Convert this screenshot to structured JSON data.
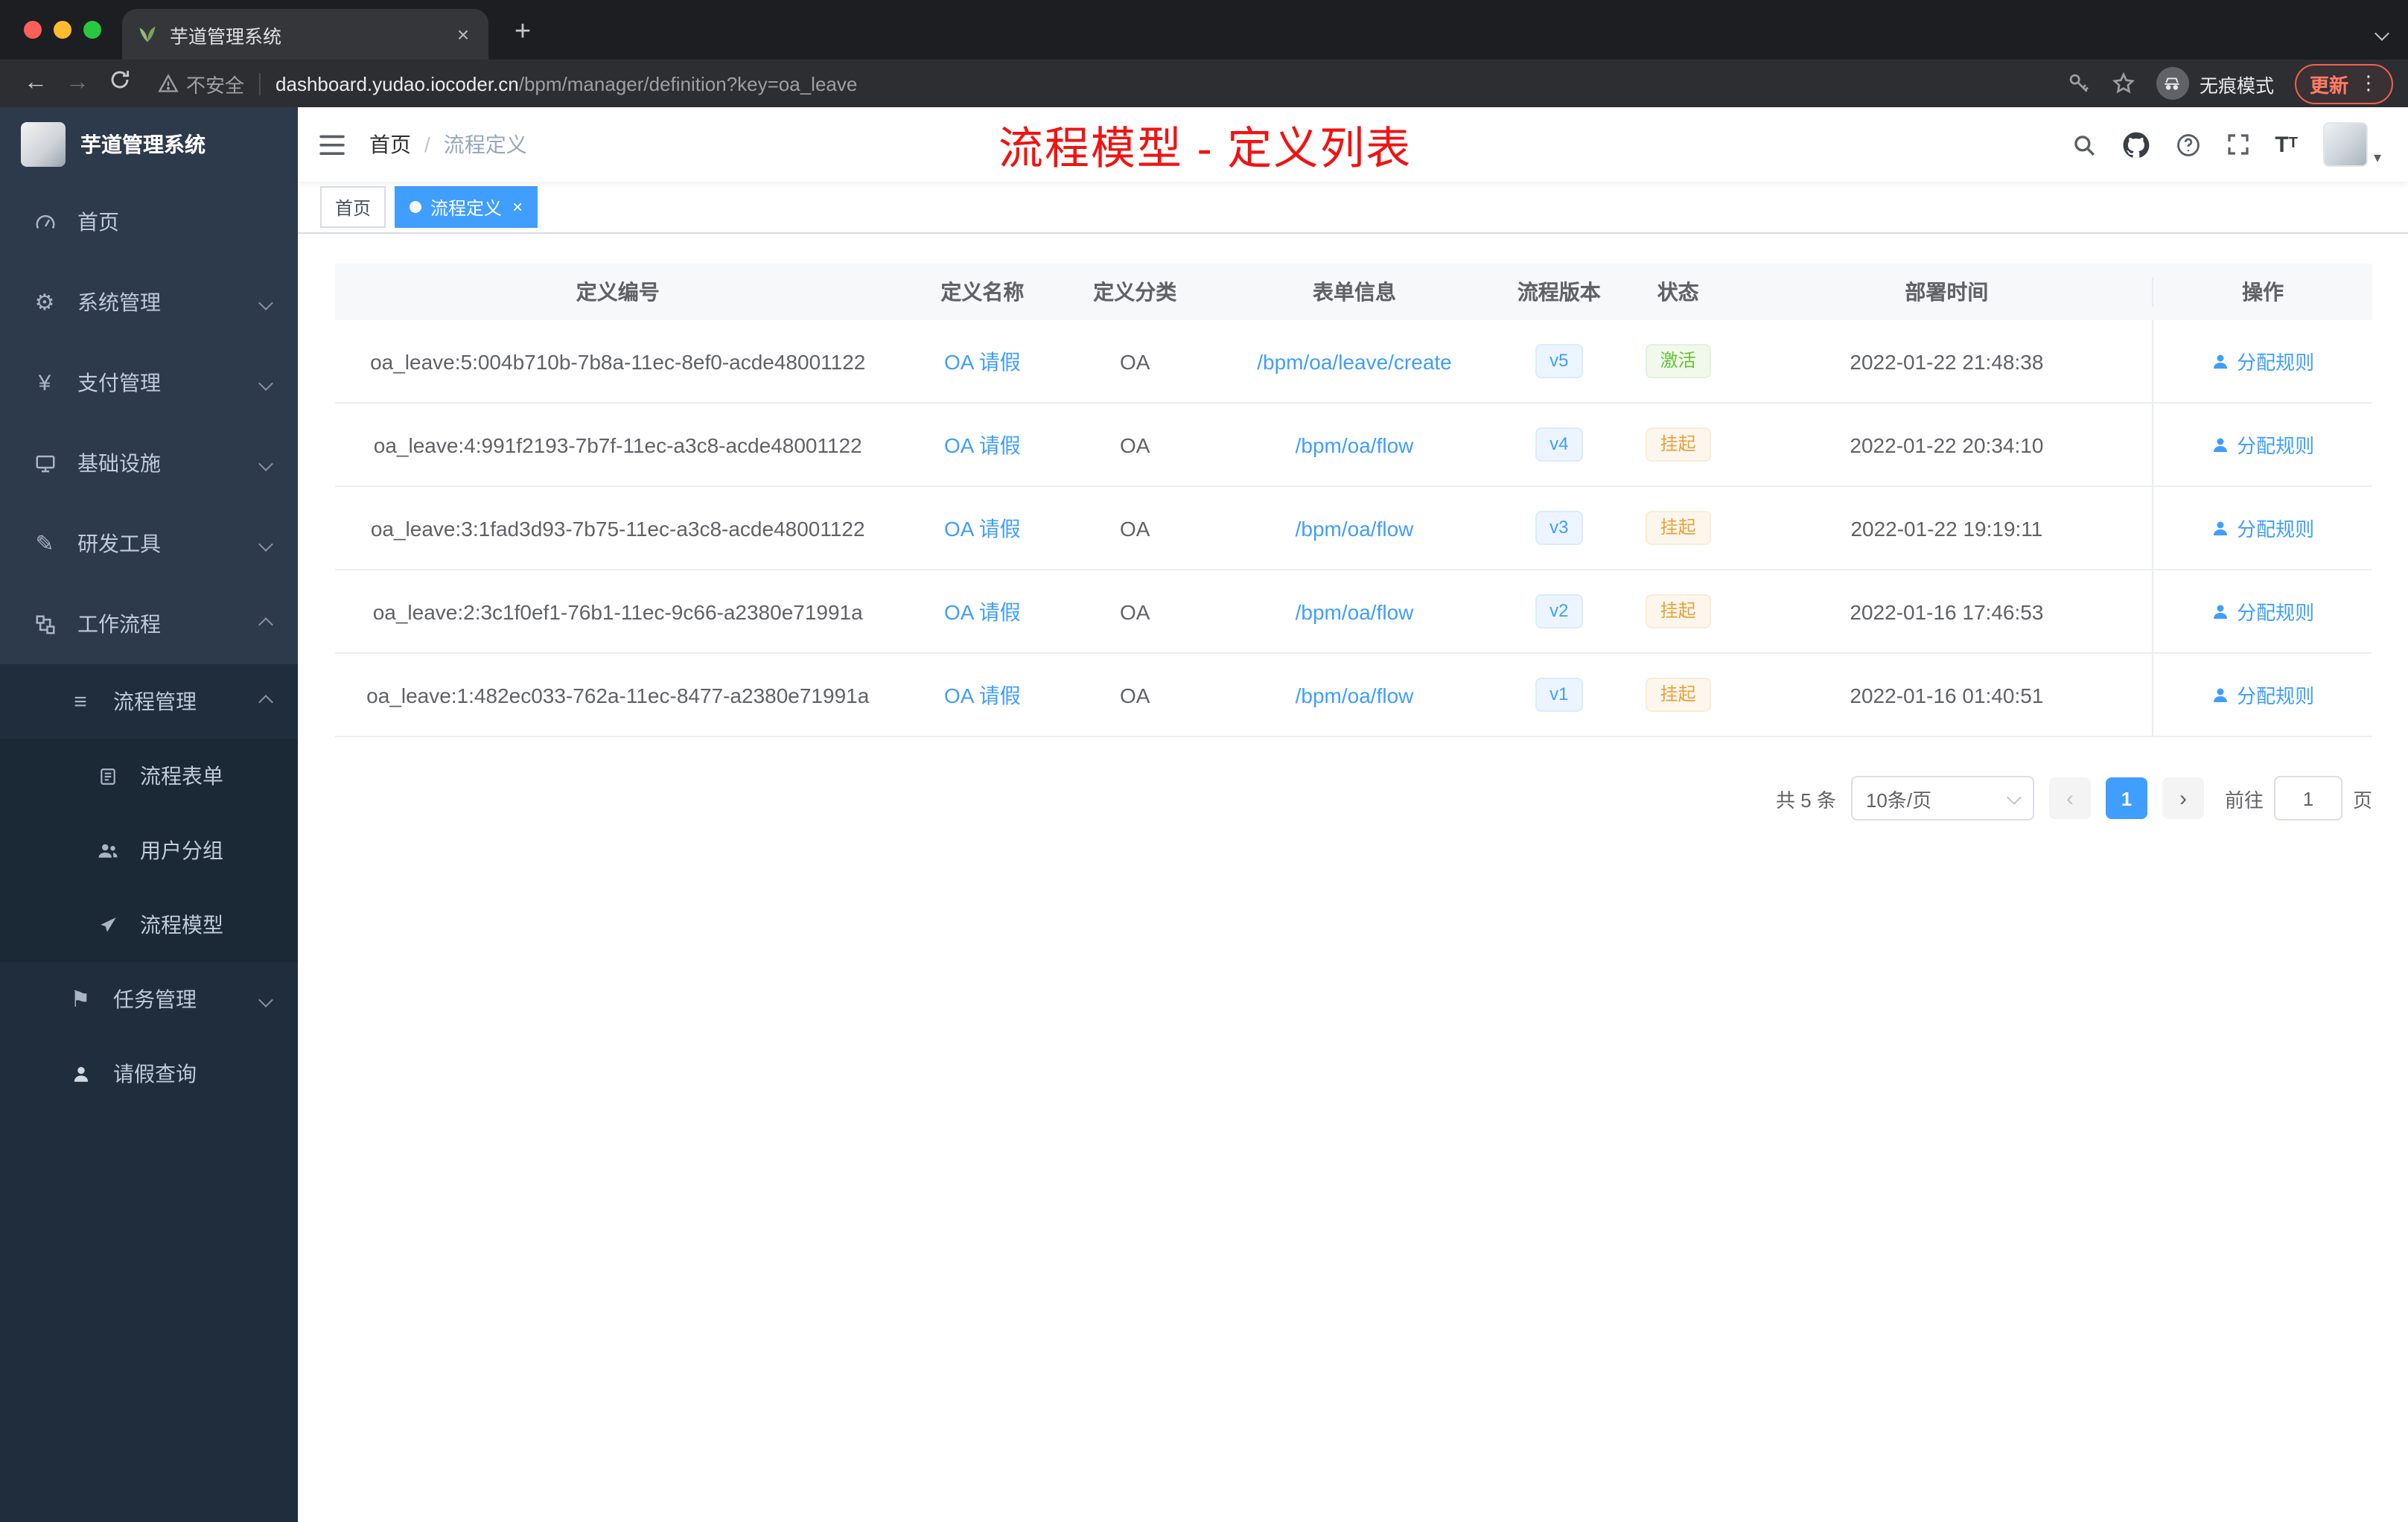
{
  "browser": {
    "tab_title": "芋道管理系统",
    "security_label": "不安全",
    "url_host": "dashboard.yudao.iocoder.cn",
    "url_path": "/bpm/manager/definition?key=oa_leave",
    "incognito_label": "无痕模式",
    "update_label": "更新"
  },
  "icons": {
    "close": "×",
    "new_tab": "+",
    "more": "⋮",
    "prev": "‹",
    "next": "›",
    "caret_down": "▾",
    "gear": "⚙",
    "yen": "¥",
    "list": "≡",
    "pencil": "✎",
    "flag": "⚑",
    "question": "?"
  },
  "sidebar": {
    "logo_title": "芋道管理系统",
    "items": [
      "首页",
      "系统管理",
      "支付管理",
      "基础设施",
      "研发工具",
      "工作流程",
      "流程管理",
      "流程表单",
      "用户分组",
      "流程模型",
      "任务管理",
      "请假查询"
    ]
  },
  "header": {
    "breadcrumb_home": "首页",
    "breadcrumb_sep": "/",
    "breadcrumb_current": "流程定义",
    "annotation": "流程模型 - 定义列表"
  },
  "tags": {
    "home": "首页",
    "active": "流程定义"
  },
  "table": {
    "columns": [
      "定义编号",
      "定义名称",
      "定义分类",
      "表单信息",
      "流程版本",
      "状态",
      "部署时间",
      "操作"
    ],
    "rows": [
      {
        "id": "oa_leave:5:004b710b-7b8a-11ec-8ef0-acde48001122",
        "name": "OA 请假",
        "category": "OA",
        "form": "/bpm/oa/leave/create",
        "version": "v5",
        "status": "激活",
        "time": "2022-01-22 21:48:38",
        "action": "分配规则"
      },
      {
        "id": "oa_leave:4:991f2193-7b7f-11ec-a3c8-acde48001122",
        "name": "OA 请假",
        "category": "OA",
        "form": "/bpm/oa/flow",
        "version": "v4",
        "status": "挂起",
        "time": "2022-01-22 20:34:10",
        "action": "分配规则"
      },
      {
        "id": "oa_leave:3:1fad3d93-7b75-11ec-a3c8-acde48001122",
        "name": "OA 请假",
        "category": "OA",
        "form": "/bpm/oa/flow",
        "version": "v3",
        "status": "挂起",
        "time": "2022-01-22 19:19:11",
        "action": "分配规则"
      },
      {
        "id": "oa_leave:2:3c1f0ef1-76b1-11ec-9c66-a2380e71991a",
        "name": "OA 请假",
        "category": "OA",
        "form": "/bpm/oa/flow",
        "version": "v2",
        "status": "挂起",
        "time": "2022-01-16 17:46:53",
        "action": "分配规则"
      },
      {
        "id": "oa_leave:1:482ec033-762a-11ec-8477-a2380e71991a",
        "name": "OA 请假",
        "category": "OA",
        "form": "/bpm/oa/flow",
        "version": "v1",
        "status": "挂起",
        "time": "2022-01-16 01:40:51",
        "action": "分配规则"
      }
    ]
  },
  "pagination": {
    "total": "共 5 条",
    "page_size": "10条/页",
    "current_page": "1",
    "goto_prefix": "前往",
    "goto_value": "1",
    "goto_suffix": "页"
  },
  "colors": {
    "accent": "#409eff",
    "success": "#67c23a",
    "warning": "#e6a23c",
    "annotation_red": "#f21212",
    "sidebar_bg": "#2d3a4b",
    "sidebar_sub_bg": "#1f2d3d"
  }
}
